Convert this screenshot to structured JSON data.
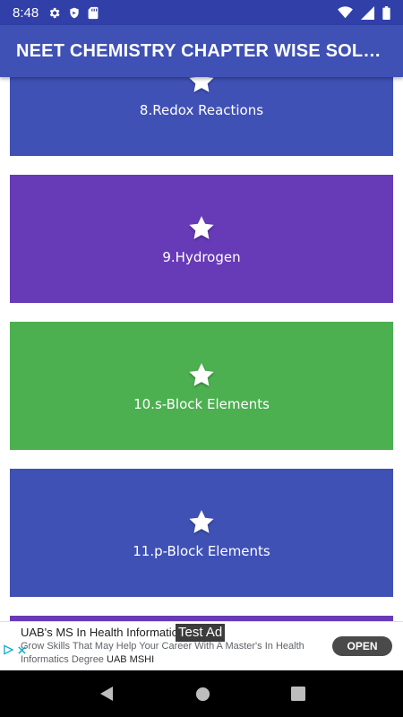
{
  "status_bar": {
    "time": "8:48",
    "icons": [
      "gear-icon",
      "shield-icon",
      "sd-card-icon",
      "wifi-icon",
      "signal-icon",
      "battery-icon"
    ]
  },
  "app_bar": {
    "title": "NEET CHEMISTRY CHAPTER WISE SOLUTIONS"
  },
  "chapters": [
    {
      "label": "8.Redox Reactions",
      "color": "#3f51b5",
      "icon": "star-icon"
    },
    {
      "label": "9.Hydrogen",
      "color": "#673ab7",
      "icon": "star-icon"
    },
    {
      "label": "10.s-Block Elements",
      "color": "#4caf50",
      "icon": "star-icon"
    },
    {
      "label": "11.p-Block Elements",
      "color": "#3f51b5",
      "icon": "star-icon"
    },
    {
      "label": "",
      "color": "#673ab7",
      "icon": "star-icon"
    }
  ],
  "ad": {
    "title": "UAB's MS In Health Informatics",
    "test_label": "Test Ad",
    "description": "Grow Skills That May Help Your Career With A Master's In Health Informatics Degree",
    "advertiser": "UAB MSHI",
    "cta": "OPEN"
  },
  "colors": {
    "status_bar": "#3140a8",
    "app_bar": "#3f51b5",
    "blue": "#3f51b5",
    "purple": "#673ab7",
    "green": "#4caf50"
  }
}
